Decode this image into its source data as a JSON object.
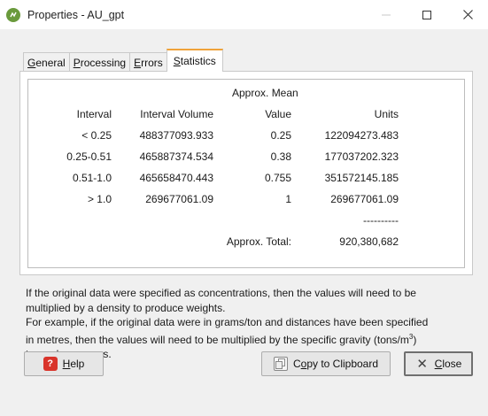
{
  "window": {
    "title": "Properties - AU_gpt"
  },
  "tabs": [
    {
      "label": "General",
      "underline_index": 0
    },
    {
      "label": "Processing",
      "underline_index": 0
    },
    {
      "label": "Errors",
      "underline_index": 0
    },
    {
      "label": "Statistics",
      "underline_index": 0
    }
  ],
  "active_tab": "Statistics",
  "stats": {
    "approx_mean_header": "Approx. Mean",
    "headers": {
      "interval": "Interval",
      "interval_volume": "Interval Volume",
      "value": "Value",
      "units": "Units"
    },
    "rows": [
      {
        "interval": "< 0.25",
        "interval_volume": "488377093.933",
        "value": "0.25",
        "units": "122094273.483"
      },
      {
        "interval": "0.25-0.51",
        "interval_volume": "465887374.534",
        "value": "0.38",
        "units": "177037202.323"
      },
      {
        "interval": "0.51-1.0",
        "interval_volume": "465658470.443",
        "value": "0.755",
        "units": "351572145.185"
      },
      {
        "interval": "> 1.0",
        "interval_volume": "269677061.09",
        "value": "1",
        "units": "269677061.09"
      }
    ],
    "separator": "----------",
    "total_label": "Approx. Total:",
    "total_value": "920,380,682"
  },
  "note": {
    "line1": "If the original data were specified as concentrations, then the values will need to be",
    "line2": "multiplied by a density to produce weights.",
    "line3": "For example, if the original data were in grams/ton and distances have been specified",
    "line4_prefix": "in metres, then the values will need to be multiplied by the specific gravity (tons/m",
    "line4_sup": "3",
    "line4_suffix": ")",
    "line5": "to produce grams."
  },
  "buttons": {
    "help": {
      "label": "Help",
      "underline_index": 0
    },
    "copy": {
      "label": "Copy to Clipboard",
      "underline_index": 1
    },
    "close": {
      "label": "Close",
      "underline_index": 0
    }
  },
  "colors": {
    "active_tab_accent": "#f0a33a",
    "app_icon": "#6a9a3c",
    "help_icon": "#d9342b"
  },
  "icons": {
    "app": "app-logo-icon",
    "help": "help-icon",
    "copy": "copy-icon",
    "close": "close-x-icon"
  }
}
